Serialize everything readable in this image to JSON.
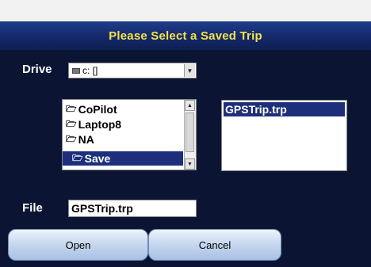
{
  "dialog": {
    "title": "Please Select a Saved Trip"
  },
  "drive": {
    "label": "Drive",
    "value": "c: []"
  },
  "folders": {
    "items": [
      {
        "label": "CoPilot",
        "selected": false
      },
      {
        "label": "Laptop8",
        "selected": false
      },
      {
        "label": "NA",
        "selected": false
      },
      {
        "label": "Save",
        "selected": true
      }
    ]
  },
  "files": {
    "items": [
      {
        "label": "GPSTrip.trp",
        "selected": true
      }
    ]
  },
  "file": {
    "label": "File",
    "value": "GPSTrip.trp"
  },
  "buttons": {
    "open_label": "Open",
    "cancel_label": "Cancel"
  },
  "colors": {
    "background": "#0b1533",
    "title_text": "#f3e24a",
    "selection": "#1d2f7a"
  }
}
